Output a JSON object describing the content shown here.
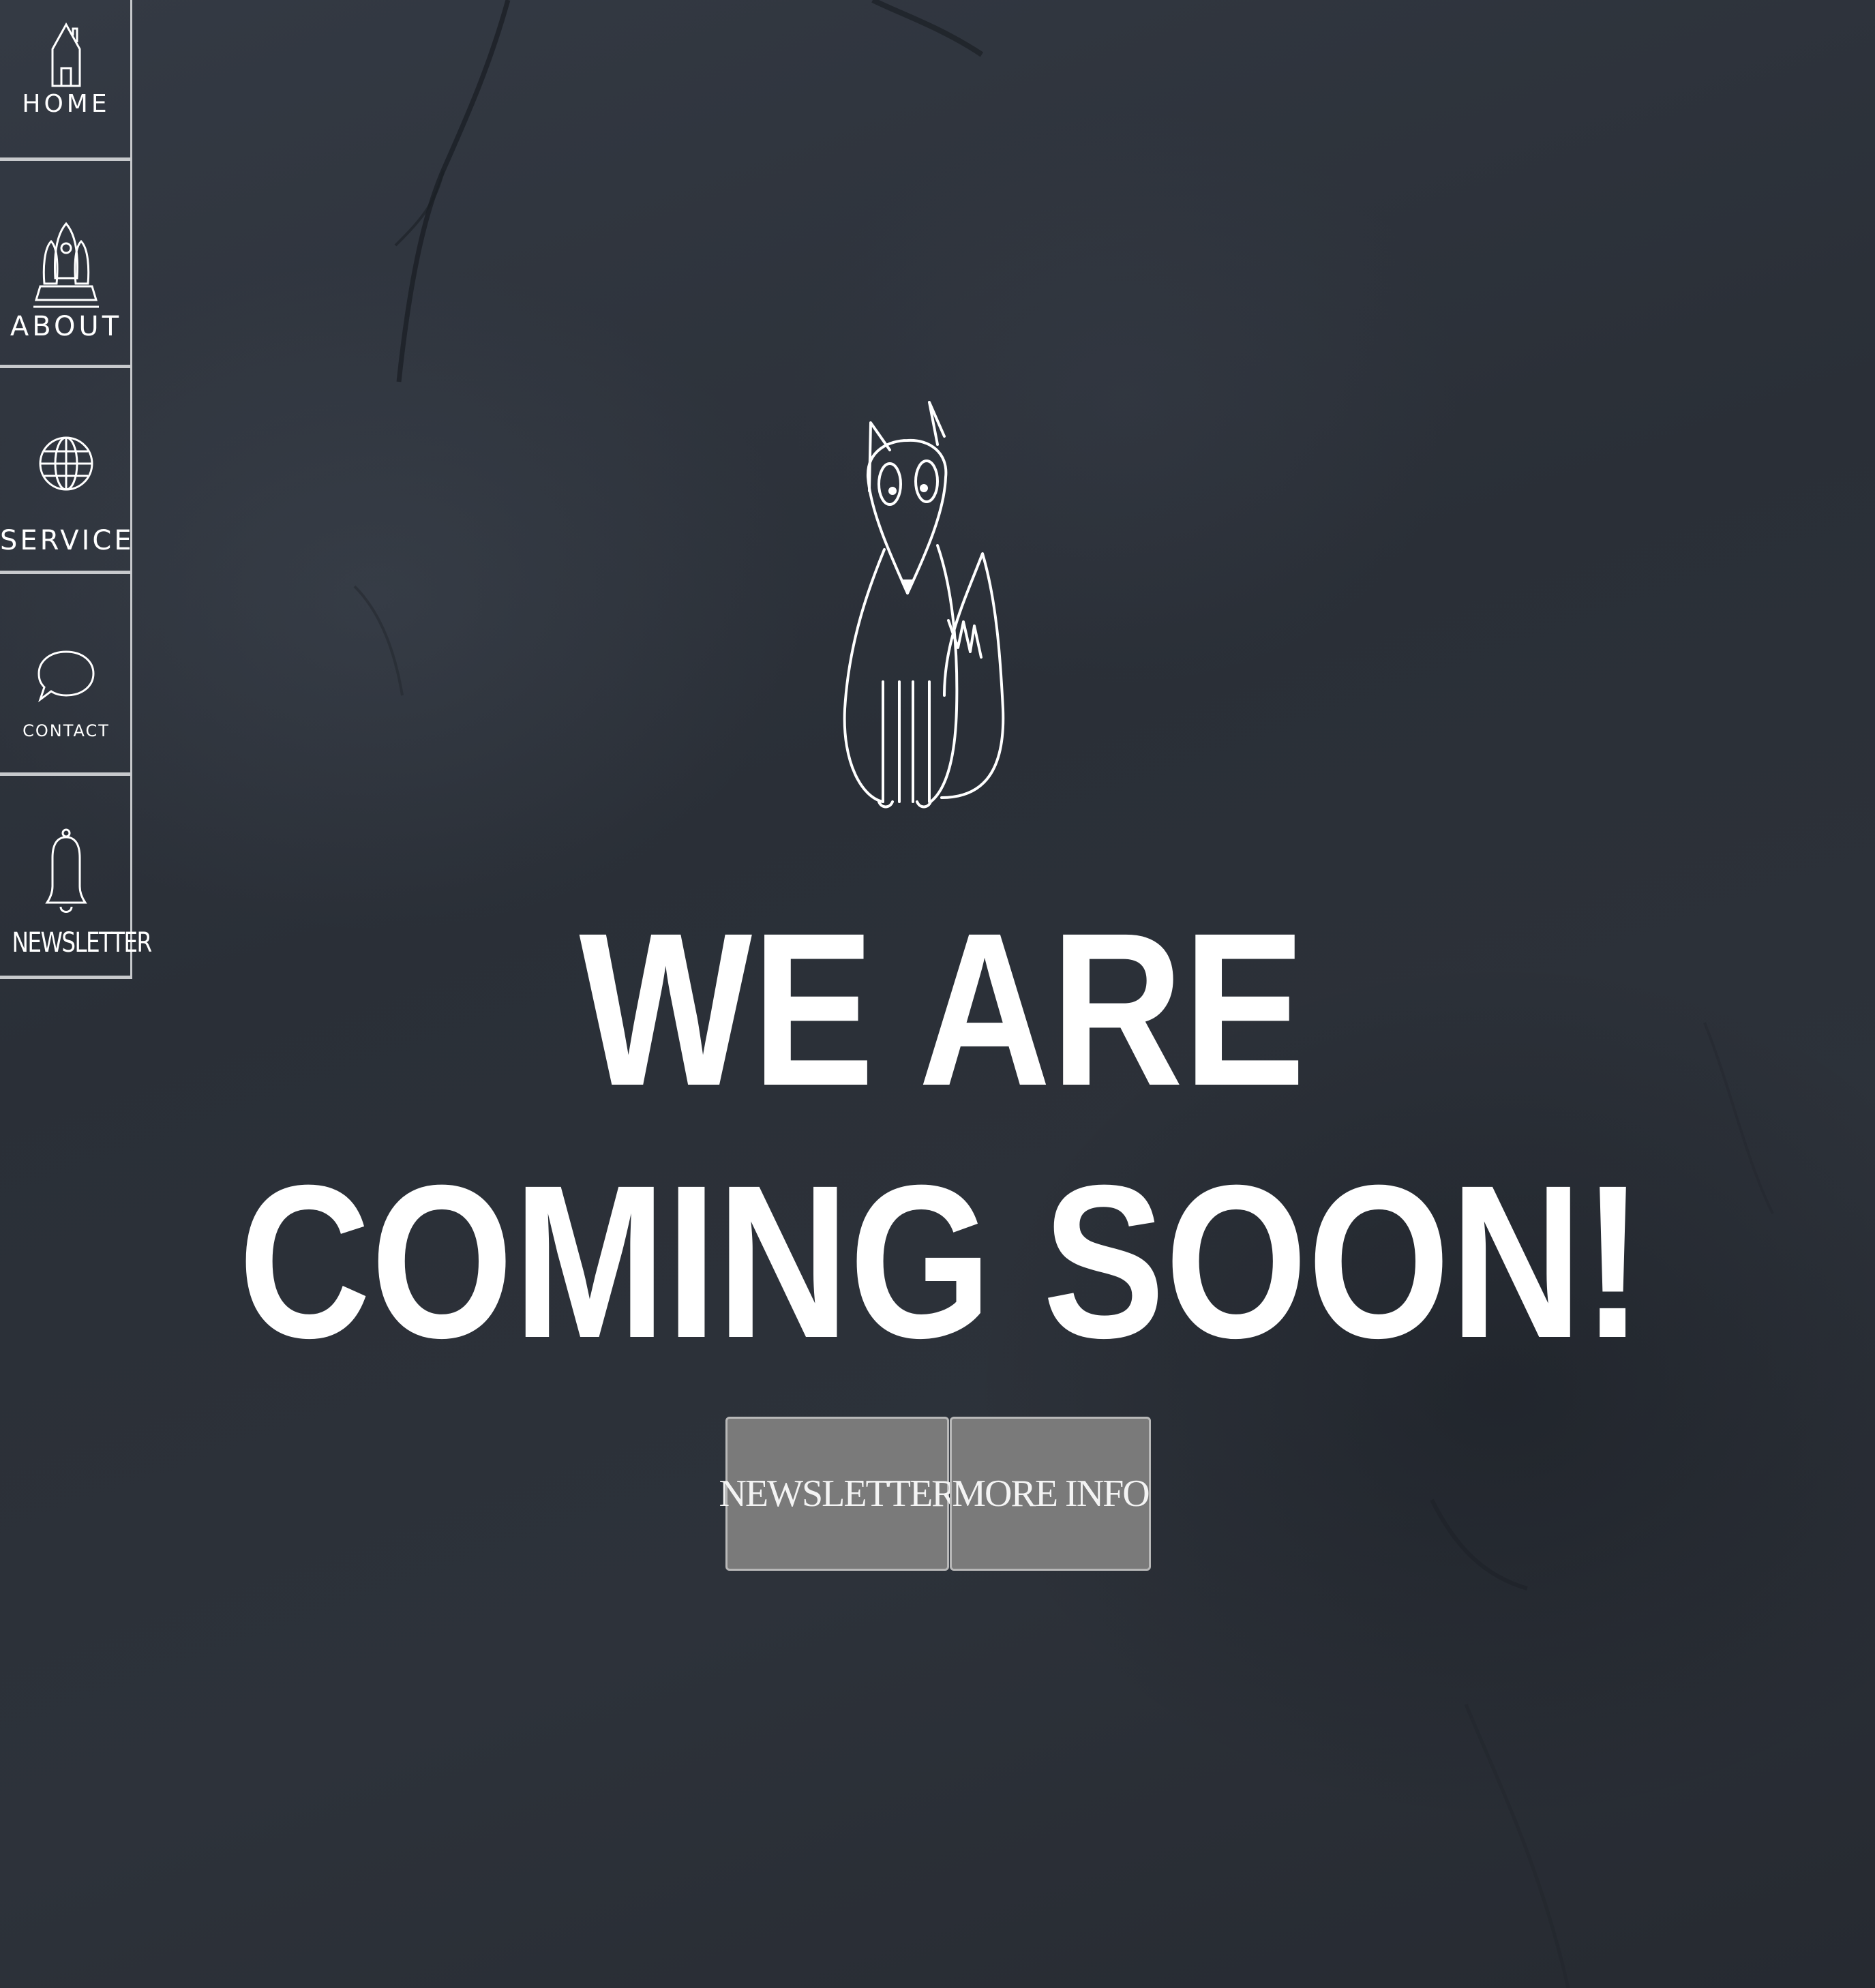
{
  "sidebar": {
    "items": [
      {
        "label": "HOME",
        "icon": "house-icon"
      },
      {
        "label": "ABOUT",
        "icon": "rocket-icon"
      },
      {
        "label": "SERVICE",
        "icon": "globe-icon"
      },
      {
        "label": "CONTACT",
        "icon": "speech-bubble-icon"
      },
      {
        "label": "NEWSLETTER",
        "icon": "bell-icon"
      }
    ]
  },
  "hero": {
    "logo": "fox-icon",
    "headline_line1": "WE ARE",
    "headline_line2": "COMING SOON!"
  },
  "buttons": {
    "newsletter_label": "NEWSLETTER",
    "more_info_label": "MORE INFO"
  },
  "colors": {
    "background": "#2c3139",
    "text": "#ffffff",
    "button_bg": "#7a7a7a",
    "nav_border": "#c7c9cc"
  }
}
